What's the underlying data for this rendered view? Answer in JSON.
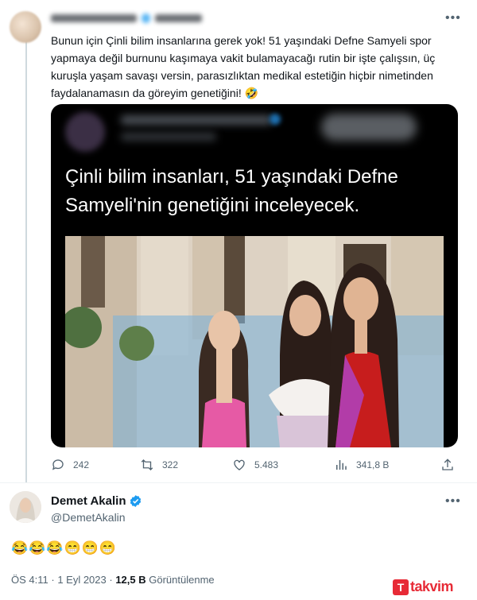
{
  "tweet": {
    "text": "Bunun için Çinli bilim insanlarına gerek yok! 51 yaşındaki Defne Samyeli spor yapmaya değil burnunu kaşımaya vakit bulamayacağı rutin bir işte çalışsın, üç kuruşla yaşam savaşı versin, parasızlıktan medikal estetiğin hiçbir nimetinden faydalanamasın da göreyim genetiğini! 🤣",
    "media_headline": "Çinli bilim insanları, 51 yaşındaki Defne Samyeli'nin genetiğini inceleyecek.",
    "actions": {
      "replies": "242",
      "retweets": "322",
      "likes": "5.483",
      "views": "341,8 B"
    }
  },
  "reply": {
    "name": "Demet Akalin",
    "handle": "@DemetAkalin",
    "body": "😂😂😂😁😁😁",
    "time": "ÖS 4:11",
    "date": "1 Eyl 2023",
    "views_count": "12,5 B",
    "views_label": "Görüntülenme"
  },
  "watermark": {
    "logo": "T",
    "text": "takvim"
  },
  "colors": {
    "accent": "#1d9bf0",
    "secondary_text": "#536471",
    "media_bg": "#000000",
    "watermark": "#e30613"
  }
}
